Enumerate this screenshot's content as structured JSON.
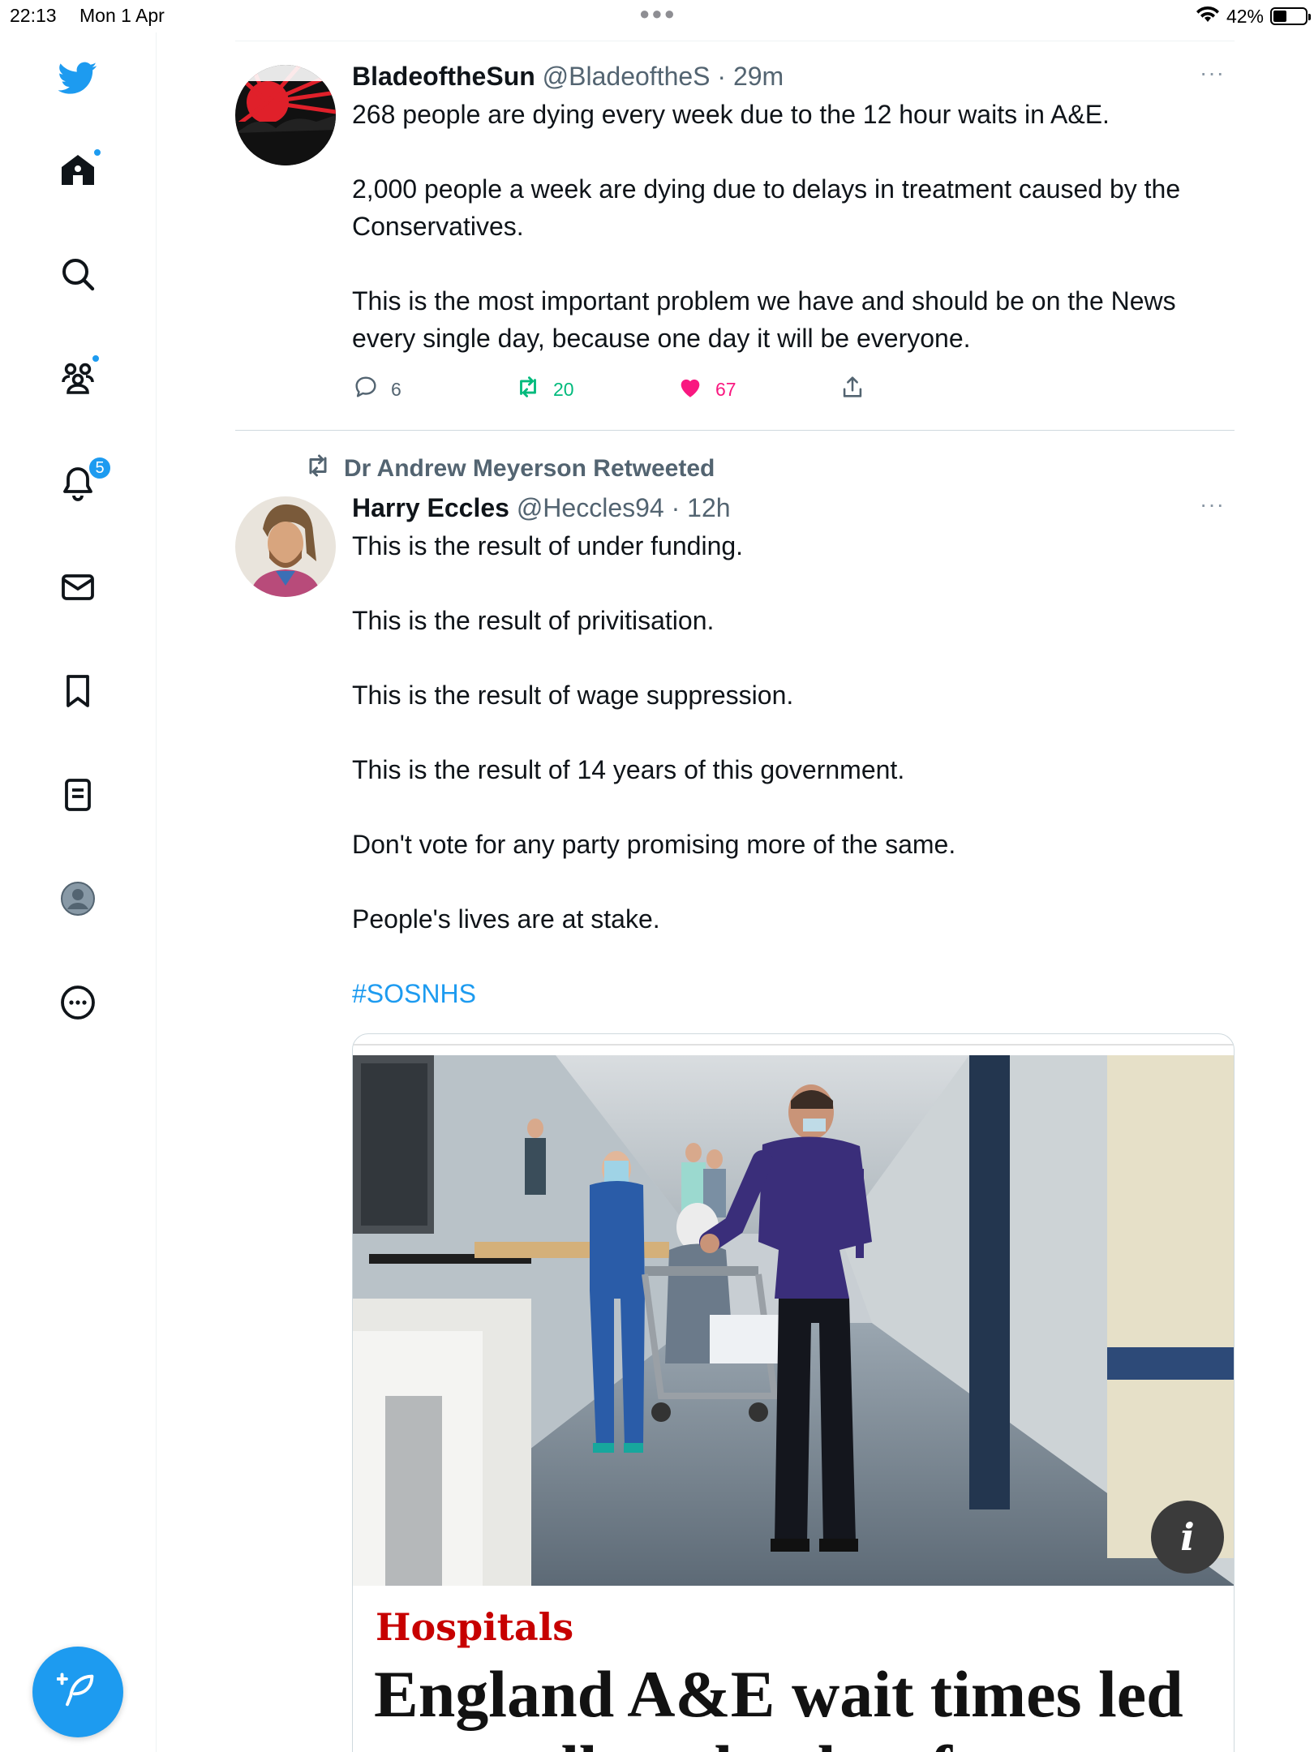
{
  "status_bar": {
    "time": "22:13",
    "date": "Mon 1 Apr",
    "battery": "42%",
    "battery_level": 0.42
  },
  "sidebar": {
    "items": [
      {
        "name": "twitter-logo",
        "icon": "bird-icon"
      },
      {
        "name": "home",
        "icon": "home-icon",
        "indicator": "dot"
      },
      {
        "name": "explore",
        "icon": "search-icon"
      },
      {
        "name": "communities",
        "icon": "people-icon",
        "indicator": "dot"
      },
      {
        "name": "notifications",
        "icon": "bell-icon",
        "badge": "5"
      },
      {
        "name": "messages",
        "icon": "mail-icon"
      },
      {
        "name": "bookmarks",
        "icon": "bookmark-icon"
      },
      {
        "name": "lists",
        "icon": "list-icon"
      },
      {
        "name": "profile",
        "icon": "profile-icon"
      },
      {
        "name": "more",
        "icon": "more-circle-icon"
      }
    ],
    "notifications_badge": "5",
    "compose": {
      "icon": "compose-feather-icon"
    }
  },
  "tweets": [
    {
      "name": "BladeoftheSun",
      "handle": "@BladeoftheS",
      "time": "· 29m",
      "more": "···",
      "paragraphs": [
        "268 people are dying every week due to the 12 hour waits in A&E.",
        "2,000 people a week are dying due to delays in treatment caused by the Conservatives.",
        "This is the most important problem we have and should be on the News every single day, because one day it will be everyone."
      ],
      "replies": "6",
      "retweets": "20",
      "likes": "67",
      "liked": true
    },
    {
      "retweeted_by": "Dr Andrew Meyerson Retweeted",
      "name": "Harry Eccles",
      "handle": "@Heccles94",
      "time": "· 12h",
      "more": "···",
      "paragraphs": [
        "This is the result of under funding.",
        "This is the result of privitisation.",
        "This is the result of wage suppression.",
        "This is the result of 14 years of this government.",
        "Don't vote for any party promising more of the same.",
        "People's lives are at stake."
      ],
      "hashtag": "#SOSNHS",
      "card": {
        "section": "Hospitals",
        "headline": "England A&E wait times led",
        "headline_cut": "to needless deaths of up to",
        "info": "i"
      }
    }
  ],
  "colors": {
    "accent": "#1d9bf0",
    "like": "#f91880",
    "retweet": "#00ba7c",
    "text": "#0f1419",
    "muted": "#536471",
    "card_section": "#c70000"
  }
}
